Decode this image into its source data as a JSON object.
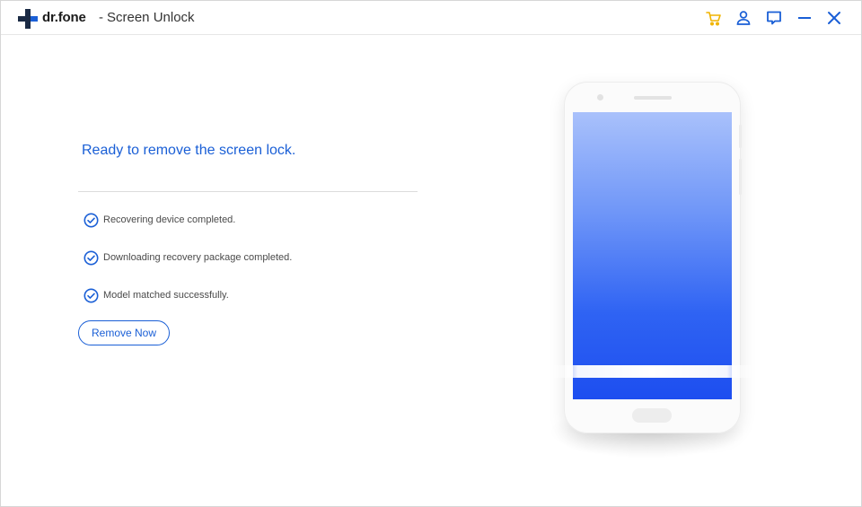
{
  "app": {
    "brand": "dr.fone",
    "separator": " - ",
    "title": "Screen Unlock"
  },
  "toolbar_icons": [
    "cart-icon",
    "user-icon",
    "feedback-icon",
    "minimize-icon",
    "close-icon"
  ],
  "main": {
    "heading": "Ready to remove the screen lock.",
    "steps": [
      {
        "label": "Recovering device completed.",
        "status": "done"
      },
      {
        "label": "Downloading recovery package completed.",
        "status": "done"
      },
      {
        "label": "Model matched successfully.",
        "status": "done"
      }
    ],
    "remove_button": "Remove Now"
  },
  "colors": {
    "accent": "#1a5fd6",
    "cart": "#f0b400",
    "screen_top": "#a9c1fb",
    "screen_bottom": "#1d4ef0"
  }
}
